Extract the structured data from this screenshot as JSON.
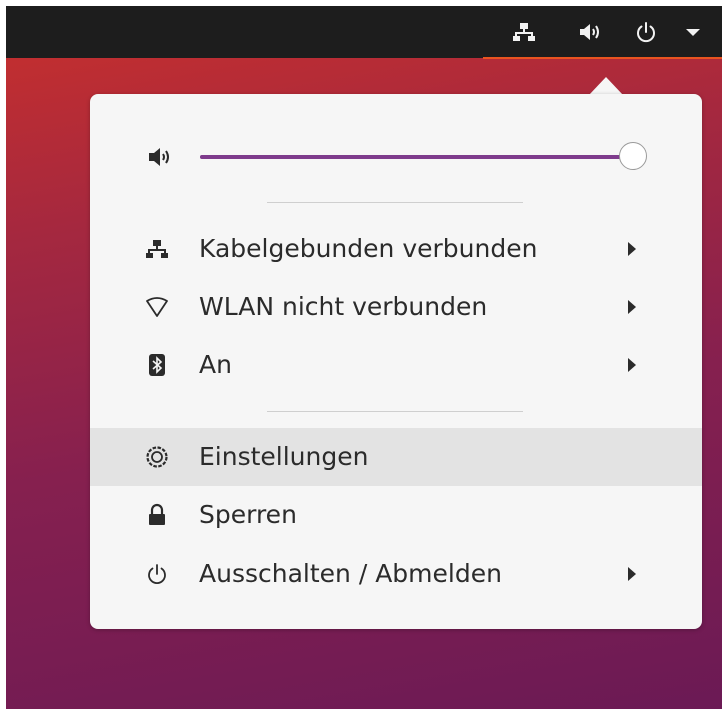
{
  "topbar": {
    "icons": [
      "network-wired-icon",
      "volume-icon",
      "power-icon",
      "dropdown-arrow-icon"
    ],
    "accent_color": "#e95420"
  },
  "volume": {
    "level_percent": 100,
    "fill_color": "#7e3b8c"
  },
  "menu": {
    "items": [
      {
        "label": "Kabelgebunden verbunden",
        "icon": "network-wired-icon",
        "has_submenu": true
      },
      {
        "label": "WLAN nicht verbunden",
        "icon": "wifi-icon",
        "has_submenu": true
      },
      {
        "label": "An",
        "icon": "bluetooth-icon",
        "has_submenu": true
      },
      {
        "label": "Einstellungen",
        "icon": "settings-icon",
        "has_submenu": false,
        "highlighted": true
      },
      {
        "label": "Sperren",
        "icon": "lock-icon",
        "has_submenu": false
      },
      {
        "label": "Ausschalten / Abmelden",
        "icon": "power-icon",
        "has_submenu": true
      }
    ]
  }
}
